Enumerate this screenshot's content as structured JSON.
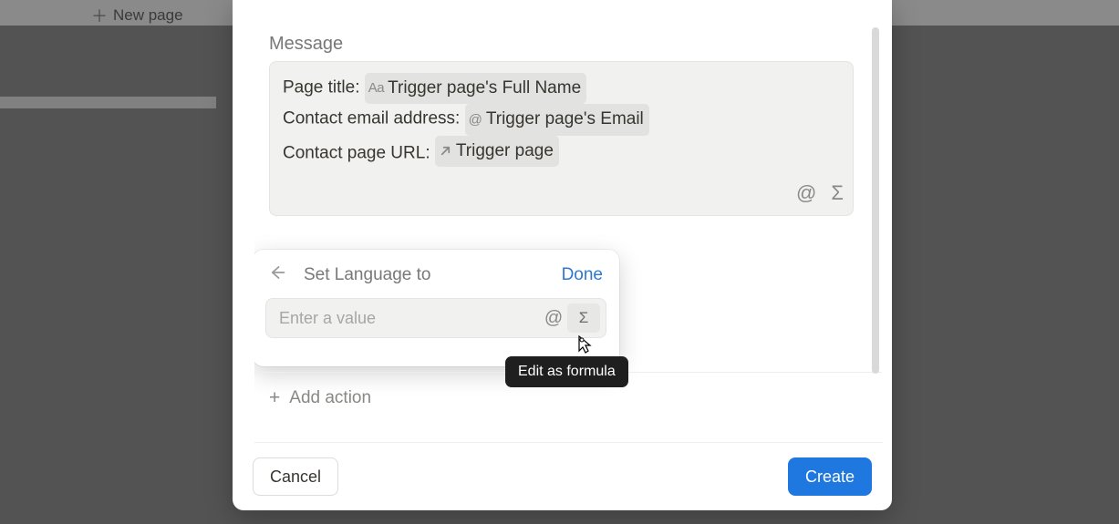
{
  "sidebar": {
    "new_page_label": "New page"
  },
  "modal": {
    "message_label": "Message",
    "message_body": {
      "line1_label": "Page title:",
      "line1_token_icon": "Aa",
      "line1_token_text": "Trigger page's Full Name",
      "line2_label": "Contact email address:",
      "line2_token_icon": "@",
      "line2_token_text": "Trigger page's Email",
      "line3_label": "Contact page URL:",
      "line3_token_text": "Trigger page"
    },
    "add_action_label": "Add action",
    "footer": {
      "cancel_label": "Cancel",
      "create_label": "Create"
    }
  },
  "popover": {
    "title": "Set Language to",
    "done_label": "Done",
    "input_placeholder": "Enter a value"
  },
  "tooltip": {
    "text": "Edit as formula"
  }
}
